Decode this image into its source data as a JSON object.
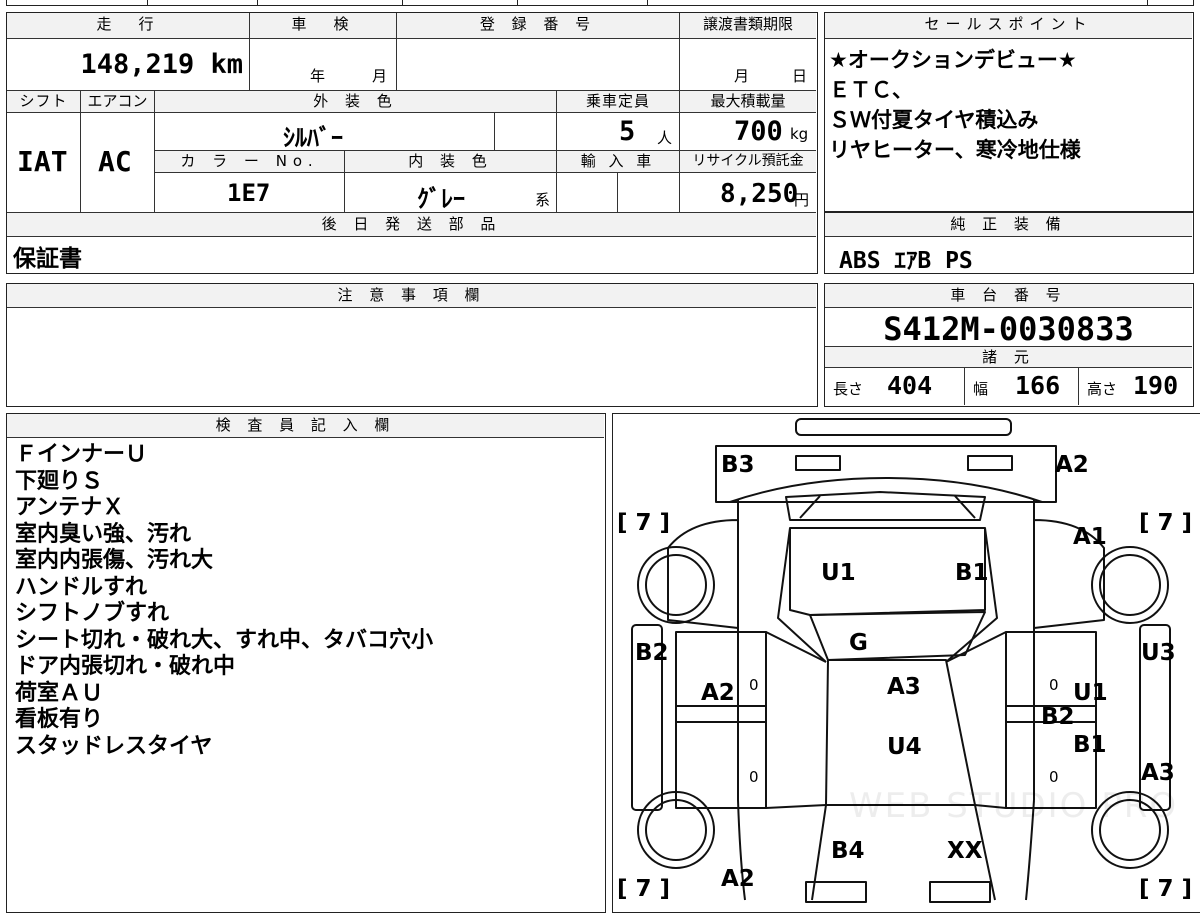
{
  "top_strip": {
    "partial_text": "■■■"
  },
  "main_table": {
    "mileage_label": "走　行",
    "mileage_value": "148,219 km",
    "inspection_label": "車　検",
    "inspection_year": "年",
    "inspection_month": "月",
    "registration_label": "登 録 番 号",
    "transfer_label": "譲渡書類期限",
    "transfer_month": "月",
    "transfer_day": "日",
    "shift_label": "シフト",
    "shift_value": "IAT",
    "aircon_label": "エアコン",
    "aircon_value": "AC",
    "exterior_color_label": "外 装 色",
    "exterior_color_value": "ｼﾙﾊﾞｰ",
    "capacity_label": "乗車定員",
    "capacity_value": "5",
    "capacity_unit": "人",
    "max_load_label": "最大積載量",
    "max_load_value": "700",
    "max_load_unit": "kg",
    "color_no_label": "カ ラ ー No.",
    "color_no_value": "1E7",
    "interior_color_label": "内 装 色",
    "interior_color_value": "ｸﾞﾚｰ",
    "interior_color_suffix": "系",
    "import_label": "輸 入 車",
    "recycle_label": "リサイクル預託金",
    "recycle_value": "8,250",
    "recycle_unit": "円",
    "later_parts_label": "後 日 発 送 部 品",
    "later_parts_value": "保証書"
  },
  "sales_points": {
    "label": "セールスポイント",
    "lines": [
      "★オークションデビュー★",
      "ＥＴＣ、",
      "ＳＷ付夏タイヤ積込み",
      "リヤヒーター、寒冷地仕様"
    ]
  },
  "genuine_equipment": {
    "label": "純 正 装 備",
    "value": "ABS ｴｱB PS"
  },
  "caution": {
    "label": "注 意 事 項 欄"
  },
  "chassis": {
    "label": "車 台 番 号",
    "value": "S412M-0030833"
  },
  "specs": {
    "label": "諸 元",
    "length_label": "長さ",
    "length_value": "404",
    "width_label": "幅",
    "width_value": "166",
    "height_label": "高さ",
    "height_value": "190"
  },
  "inspector": {
    "label": "検 査 員 記 入 欄",
    "lines": [
      "ＦインナーＵ",
      "下廻りＳ",
      "アンテナＸ",
      "室内臭い強、汚れ",
      "室内内張傷、汚れ大",
      "ハンドルすれ",
      "シフトノブすれ",
      "シート切れ・破れ大、すれ中、タバコ穴小",
      "ドア内張切れ・破れ中",
      "荷室ＡＵ",
      "看板有り",
      "スタッドレスタイヤ"
    ]
  },
  "diagram": {
    "marks": {
      "b3": "B3",
      "a2_top": "A2",
      "a1": "A1",
      "u1_hood": "U1",
      "b1_hood": "B1",
      "g": "G",
      "b2_left": "B2",
      "a2_left": "A2",
      "a3_roof": "A3",
      "u4": "U4",
      "u3": "U3",
      "u1_right": "U1",
      "b2_right": "B2",
      "b1_right": "B1",
      "a3_right": "A3",
      "b4": "B4",
      "xx": "XX",
      "a2_bottom": "A2"
    },
    "tire_tl": "[ 7 ]",
    "tire_tr": "[ 7 ]",
    "tire_bl": "[ 7 ]",
    "tire_br": "[ 7 ]",
    "zero1": "0",
    "zero2": "0",
    "zero3": "0",
    "zero4": "0",
    "watermark": "WEB STUDIO PRO"
  }
}
